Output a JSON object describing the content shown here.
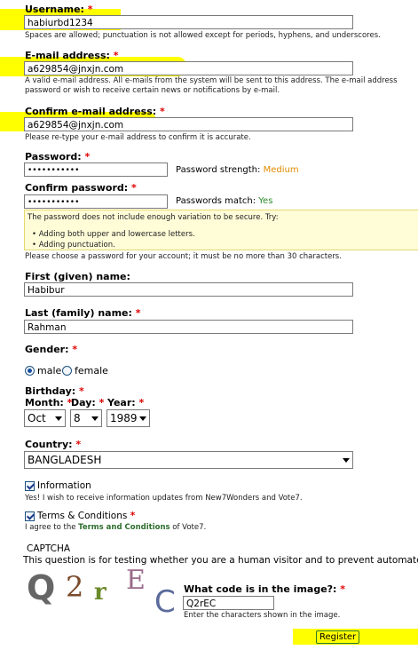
{
  "username": {
    "label": "Username:",
    "req": "*",
    "value": "habiurbd1234",
    "desc": "Spaces are allowed; punctuation is not allowed except for periods, hyphens, and underscores."
  },
  "email": {
    "label": "E-mail address:",
    "req": "*",
    "value": "a629854@jnxjn.com",
    "desc1": "A valid e-mail address. All e-mails from the system will be sent to this address. The e-mail address",
    "desc2": "password or wish to receive certain news or notifications by e-mail."
  },
  "confirm_email": {
    "label": "Confirm e-mail address:",
    "req": "*",
    "value": "a629854@jnxjn.com",
    "desc": "Please re-type your e-mail address to confirm it is accurate."
  },
  "password": {
    "label": "Password:",
    "req": "*",
    "value": "•••••••••••",
    "strength_label": "Password strength:",
    "strength_value": "Medium"
  },
  "confirm_password": {
    "label": "Confirm password:",
    "req": "*",
    "value": "•••••••••••",
    "match_label": "Passwords match:",
    "match_value": "Yes"
  },
  "password_hint": {
    "intro": "The password does not include enough variation to be secure. Try:",
    "items": [
      "Adding both upper and lowercase letters.",
      "Adding punctuation."
    ],
    "note": "Please choose a password for your account; it must be no more than 30 characters."
  },
  "first_name": {
    "label": "First (given) name:",
    "value": "Habibur"
  },
  "last_name": {
    "label": "Last (family) name:",
    "req": "*",
    "value": "Rahman"
  },
  "gender": {
    "label": "Gender:",
    "req": "*",
    "options": [
      "male",
      "female"
    ],
    "selected": "male"
  },
  "birthday": {
    "label": "Birthday:",
    "req": "*",
    "month_label": "Month:",
    "day_label": "Day:",
    "year_label": "Year:",
    "month": "Oct",
    "day": "8",
    "year": "1989"
  },
  "country": {
    "label": "Country:",
    "req": "*",
    "value": "BANGLADESH"
  },
  "information": {
    "label": "Information",
    "checked": true,
    "desc": "Yes! I wish to receive information updates from New7Wonders and Vote7."
  },
  "terms": {
    "label": "Terms & Conditions",
    "req": "*",
    "checked": true,
    "desc_pre": "I agree to the ",
    "desc_link": "Terms and Conditions",
    "desc_post": " of Vote7."
  },
  "captcha": {
    "title": "CAPTCHA",
    "desc": "This question is for testing whether you are a human visitor and to prevent automated spam submissions.",
    "image_chars": [
      "Q",
      "2",
      "r",
      "E",
      "C"
    ],
    "question": "What code is in the image?:",
    "req": "*",
    "value": "Q2rEC",
    "hint": "Enter the characters shown in the image."
  },
  "register_label": "Register",
  "colors": {
    "highlight": "#ffff00",
    "required": "#dd0000",
    "strength": "#e08a00",
    "match": "#2a8a2a",
    "link": "#2f6f2f"
  }
}
